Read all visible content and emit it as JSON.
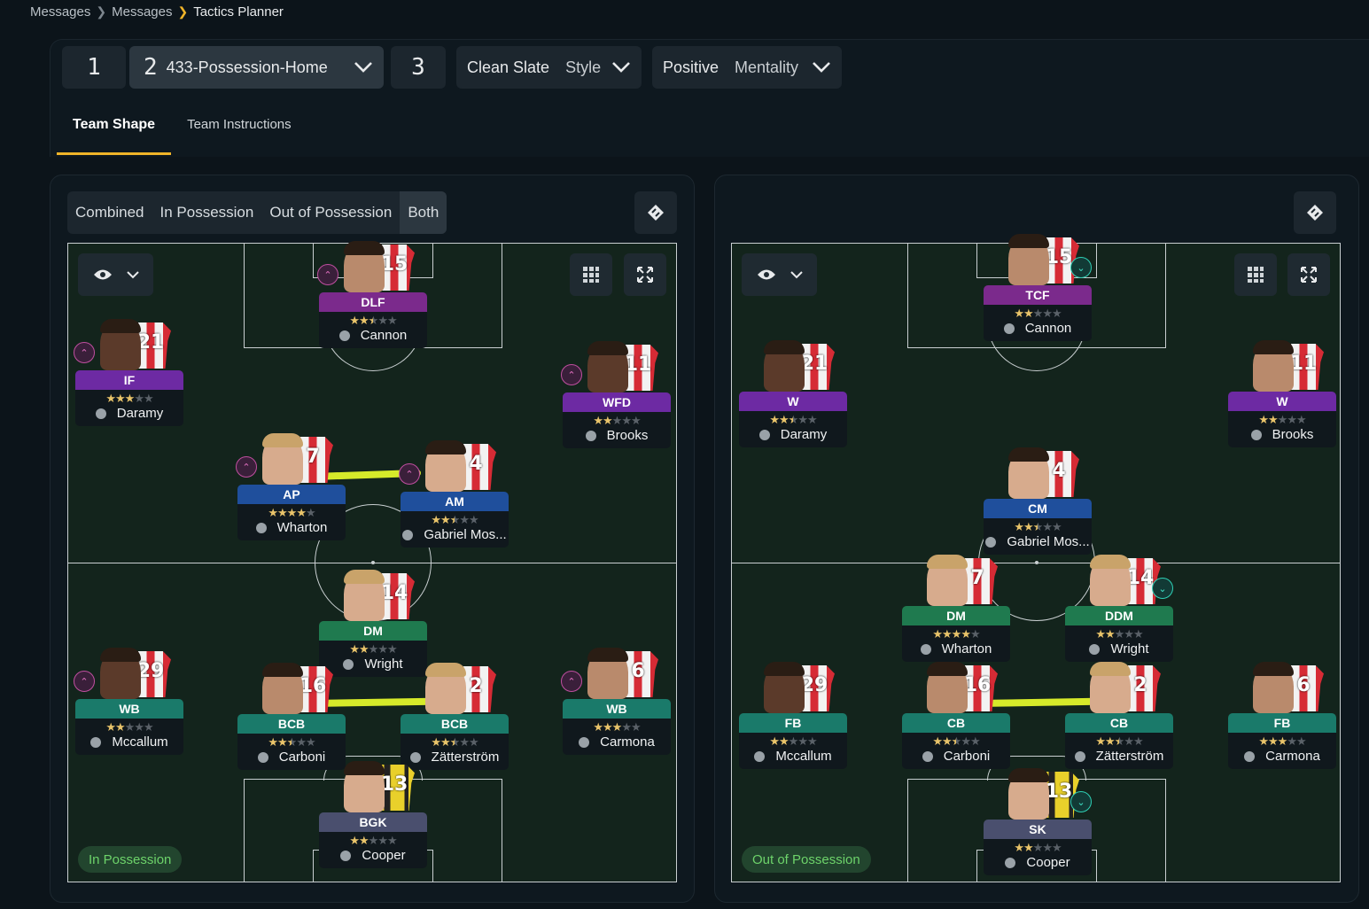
{
  "breadcrumb": [
    "Messages",
    "Messages",
    "Tactics Planner"
  ],
  "tactic_slots": [
    {
      "num": "1"
    },
    {
      "num": "2",
      "name": "433-Possession-Home"
    },
    {
      "num": "3"
    }
  ],
  "style": {
    "value": "Clean Slate",
    "label": "Style"
  },
  "mentality": {
    "value": "Positive",
    "label": "Mentality"
  },
  "tabs": [
    "Team Shape",
    "Team Instructions"
  ],
  "view_options": [
    "Combined",
    "In Possession",
    "Out of Possession",
    "Both"
  ],
  "phase_labels": {
    "left": "In Possession",
    "right": "Out of Possession"
  },
  "left_players": [
    {
      "role": "DLF",
      "stars": 2.5,
      "name": "Cannon",
      "number": "15"
    },
    {
      "role": "IF",
      "stars": 3,
      "name": "Daramy",
      "number": "21"
    },
    {
      "role": "WFD",
      "stars": 2,
      "name": "Brooks",
      "number": "11"
    },
    {
      "role": "AP",
      "stars": 4,
      "name": "Wharton",
      "number": "7"
    },
    {
      "role": "AM",
      "stars": 2.5,
      "name": "Gabriel Mos...",
      "number": "4"
    },
    {
      "role": "DM",
      "stars": 2,
      "name": "Wright",
      "number": "14"
    },
    {
      "role": "WB",
      "stars": 2,
      "name": "Mccallum",
      "number": "29"
    },
    {
      "role": "WB",
      "stars": 3,
      "name": "Carmona",
      "number": "6"
    },
    {
      "role": "BCB",
      "stars": 2.5,
      "name": "Carboni",
      "number": "16"
    },
    {
      "role": "BCB",
      "stars": 2.5,
      "name": "Zätterström",
      "number": "2"
    },
    {
      "role": "BGK",
      "stars": 2,
      "name": "Cooper",
      "number": "13"
    }
  ],
  "right_players": [
    {
      "role": "TCF",
      "stars": 2,
      "name": "Cannon",
      "number": "15"
    },
    {
      "role": "W",
      "stars": 2.5,
      "name": "Daramy",
      "number": "21"
    },
    {
      "role": "W",
      "stars": 2,
      "name": "Brooks",
      "number": "11"
    },
    {
      "role": "CM",
      "stars": 2.5,
      "name": "Gabriel Mos...",
      "number": "4"
    },
    {
      "role": "DM",
      "stars": 4,
      "name": "Wharton",
      "number": "7"
    },
    {
      "role": "DDM",
      "stars": 2,
      "name": "Wright",
      "number": "14"
    },
    {
      "role": "FB",
      "stars": 2,
      "name": "Mccallum",
      "number": "29"
    },
    {
      "role": "CB",
      "stars": 2.5,
      "name": "Carboni",
      "number": "16"
    },
    {
      "role": "CB",
      "stars": 2.5,
      "name": "Zätterström",
      "number": "2"
    },
    {
      "role": "FB",
      "stars": 3,
      "name": "Carmona",
      "number": "6"
    },
    {
      "role": "SK",
      "stars": 2,
      "name": "Cooper",
      "number": "13"
    }
  ],
  "colors": {
    "accent": "#f0b429",
    "link": "#d6ea2a",
    "pitch": "#13241c"
  }
}
